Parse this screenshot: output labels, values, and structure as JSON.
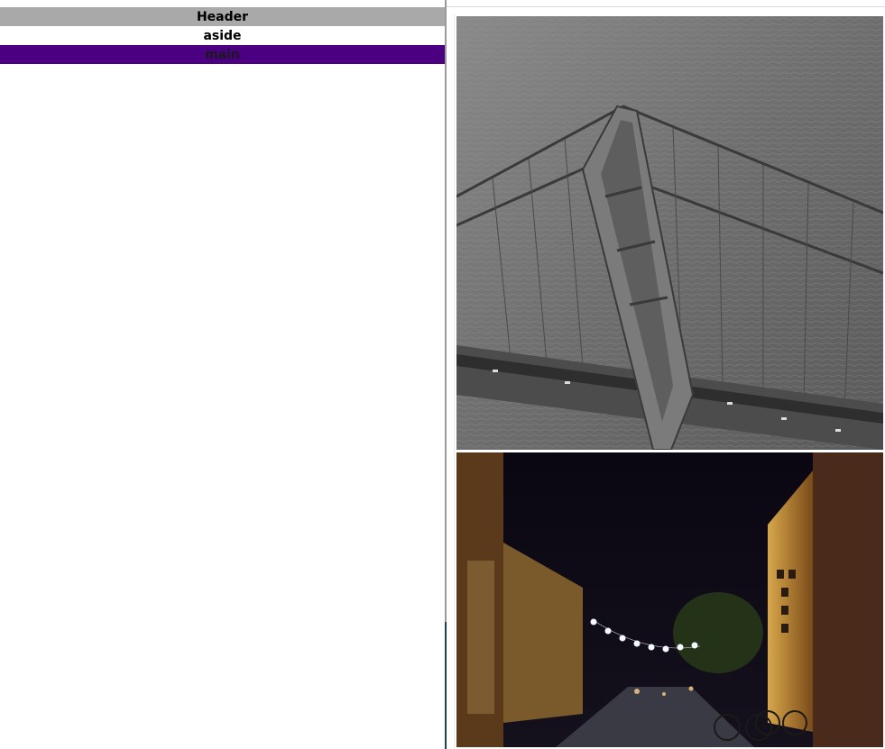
{
  "layout_demo": {
    "header_label": "Header",
    "aside_label": "aside",
    "main_label": "main"
  },
  "colors": {
    "header_bg": "#a9a9a9",
    "aside_bg": "#ffffff",
    "main_bg": "#4b0082"
  },
  "images": [
    {
      "name": "bridge-photo",
      "subject": "aerial grayscale suspension bridge tower over water"
    },
    {
      "name": "street-photo",
      "subject": "night street with string lights and old buildings"
    }
  ]
}
